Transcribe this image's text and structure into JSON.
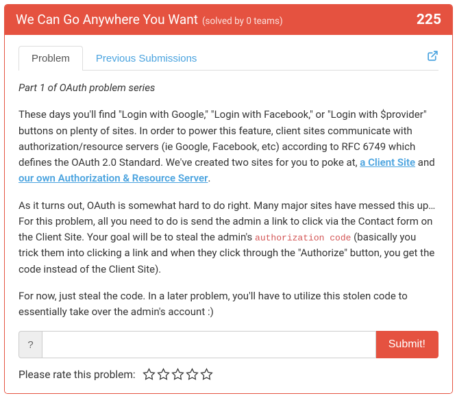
{
  "header": {
    "title": "We Can Go Anywhere You Want",
    "solved": "(solved by 0 teams)",
    "points": "225"
  },
  "tabs": {
    "problem": "Problem",
    "previous": "Previous Submissions"
  },
  "content": {
    "subtitle": "Part 1 of OAuth problem series",
    "p1a": "These days you'll find \"Login with Google,\" \"Login with Facebook,\" or \"Login with $provider\" buttons on plenty of sites. In order to power this feature, client sites communicate with authorization/resource servers (ie Google, Facebook, etc) according to RFC 6749 which defines the OAuth 2.0 Standard. We've created two sites for you to poke at, ",
    "link1": "a Client Site",
    "p1b": " and ",
    "link2": "our own Authorization & Resource Server",
    "p1c": ".",
    "p2a": "As it turns out, OAuth is somewhat hard to do right. Many major sites have messed this up… For this problem, all you need to do is send the admin a link to click via the Contact form on the Client Site. Your goal will be to steal the admin's ",
    "code": "authorization code",
    "p2b": " (basically you trick them into clicking a link and when they click through the \"Authorize\" button, you get the code instead of the Client Site).",
    "p3": "For now, just steal the code. In a later problem, you'll have to utilize this stolen code to essentially take over the admin's account :)"
  },
  "answer": {
    "hint": "?",
    "placeholder": "",
    "submit": "Submit!"
  },
  "rating": {
    "label": "Please rate this problem:"
  }
}
